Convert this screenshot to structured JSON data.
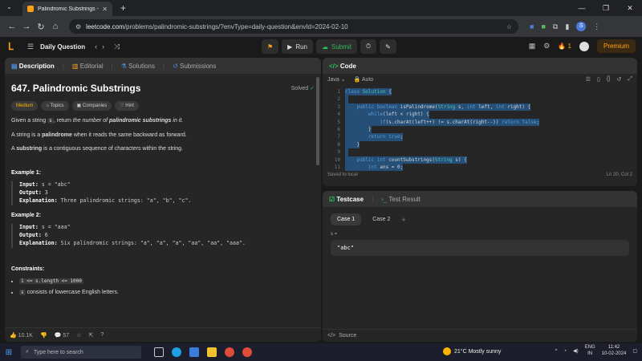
{
  "browser": {
    "tab_title": "Palindromic Substrings - LeetC",
    "url_host": "leetcode.com",
    "url_path": "/problems/palindromic-substrings/?envType=daily-question&envId=2024-02-10"
  },
  "lcnav": {
    "daily_question": "Daily Question",
    "run": "Run",
    "submit": "Submit",
    "streak": "1",
    "premium": "Premium"
  },
  "left": {
    "tabs": [
      "Description",
      "Editorial",
      "Solutions",
      "Submissions"
    ],
    "title": "647. Palindromic Substrings",
    "solved": "Solved",
    "tags": [
      "Medium",
      "Topics",
      "Companies",
      "Hint"
    ],
    "desc1_a": "Given a string ",
    "desc1_code": "s",
    "desc1_b": ", return ",
    "desc1_it": "the number of ",
    "desc1_bi": "palindromic substrings",
    "desc1_c": " in it.",
    "desc2_a": "A string is a ",
    "desc2_b": "palindrome",
    "desc2_c": " when it reads the same backward as forward.",
    "desc3_a": "A ",
    "desc3_b": "substring",
    "desc3_c": " is a contiguous sequence of characters within the string.",
    "examples": [
      {
        "title": "Example 1:",
        "input": "s = \"abc\"",
        "output": "3",
        "explanation": "Three palindromic strings: \"a\", \"b\", \"c\"."
      },
      {
        "title": "Example 2:",
        "input": "s = \"aaa\"",
        "output": "6",
        "explanation": "Six palindromic strings: \"a\", \"a\", \"a\", \"aa\", \"aa\", \"aaa\"."
      }
    ],
    "input_label": "Input:",
    "output_label": "Output:",
    "explanation_label": "Explanation:",
    "constraints_title": "Constraints:",
    "constraint1": "1 <= s.length <= 1000",
    "constraint2_code": "s",
    "constraint2_text": " consists of lowercase English letters.",
    "likes": "10.1K",
    "comments": "57"
  },
  "code": {
    "header": "Code",
    "language": "Java",
    "mode": "Auto",
    "line_numbers": [
      "1",
      "2",
      "3",
      "4",
      "5",
      "6",
      "7",
      "8",
      "9",
      "10",
      "11"
    ],
    "saved": "Saved to local",
    "cursor": "Ln 20, Col 2"
  },
  "test": {
    "tab_testcase": "Testcase",
    "tab_result": "Test Result",
    "case1": "Case 1",
    "case2": "Case 2",
    "var_label": "s =",
    "value": "\"abc\"",
    "source": "Source"
  },
  "taskbar": {
    "search_placeholder": "Type here to search",
    "weather": "21°C  Mostly sunny",
    "lang": "ENG",
    "region": "IN",
    "time": "11:42",
    "date": "10-02-2024"
  }
}
